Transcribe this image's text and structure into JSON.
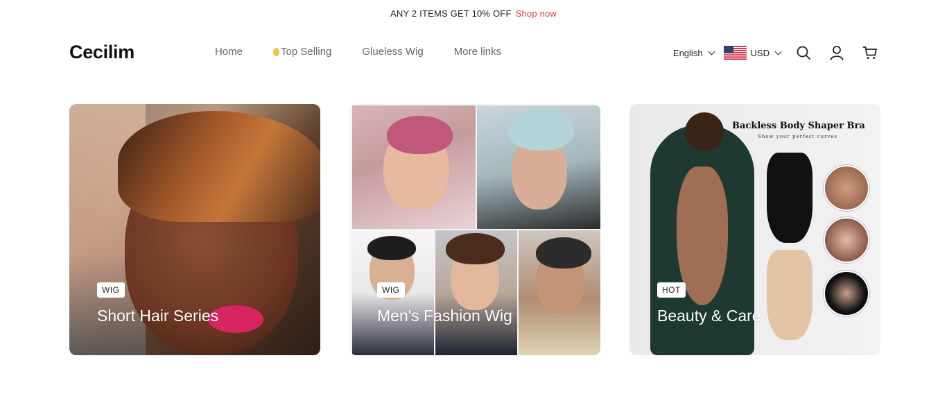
{
  "announcement": {
    "text": "ANY 2 ITEMS GET 10% OFF",
    "link": "Shop now",
    "link_color": "#e0393e"
  },
  "header": {
    "logo": "Cecilim",
    "nav": [
      {
        "label": "Home"
      },
      {
        "label": "Top Selling",
        "icon": "flame-icon"
      },
      {
        "label": "Glueless Wig"
      },
      {
        "label": "More links"
      }
    ],
    "language": "English",
    "currency": "USD",
    "icons": [
      "search-icon",
      "account-icon",
      "cart-icon"
    ]
  },
  "cards": [
    {
      "tag": "WIG",
      "title": "Short Hair Series"
    },
    {
      "tag": "WIG",
      "title": "Men's Fashion Wig"
    },
    {
      "tag": "HOT",
      "title": "Beauty & Care",
      "image_heading": "Backless Body Shaper Bra",
      "image_subheading": "Show your perfect curves"
    }
  ]
}
